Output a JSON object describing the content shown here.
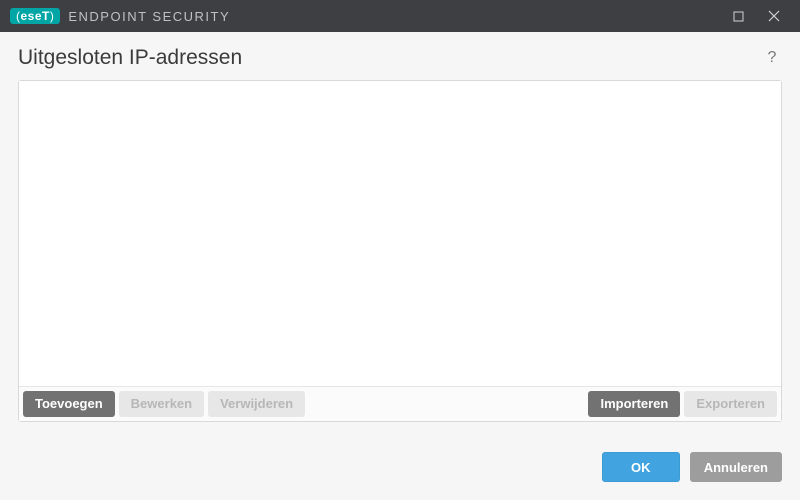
{
  "titlebar": {
    "logo_text": "(eseT)",
    "product_name": "ENDPOINT SECURITY"
  },
  "page": {
    "title": "Uitgesloten IP-adressen"
  },
  "panel_actions": {
    "add": "Toevoegen",
    "edit": "Bewerken",
    "remove": "Verwijderen",
    "import": "Importeren",
    "export": "Exporteren"
  },
  "footer": {
    "ok": "OK",
    "cancel": "Annuleren"
  },
  "list": {
    "items": []
  }
}
